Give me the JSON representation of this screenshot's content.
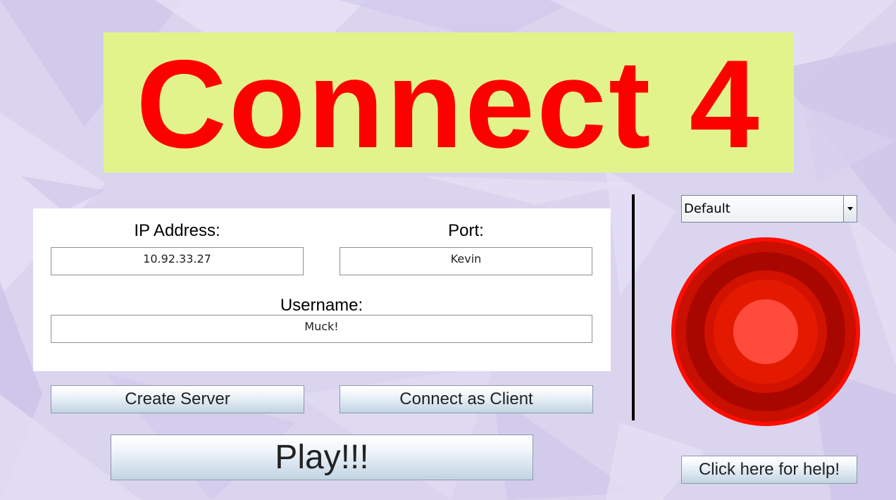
{
  "app": {
    "title": "Connect 4"
  },
  "form": {
    "ip_label": "IP Address:",
    "ip_value": "10.92.33.27",
    "port_label": "Port:",
    "port_value": "Kevin",
    "username_label": "Username:",
    "username_value": "Muck!"
  },
  "buttons": {
    "create_server": "Create Server",
    "connect_client": "Connect as Client",
    "play": "Play!!!",
    "help": "Click here for help!"
  },
  "theme_select": {
    "selected": "Default"
  },
  "icons": {
    "dropdown": "chevron-down-icon",
    "piece": "red-disc-icon"
  },
  "colors": {
    "title_text": "#ff0000",
    "title_background": "#e3f38b",
    "disc_rings": [
      "#ff0d00",
      "#c90f00",
      "#a80700",
      "#d21200",
      "#e41a00",
      "#ff4b3b"
    ]
  }
}
